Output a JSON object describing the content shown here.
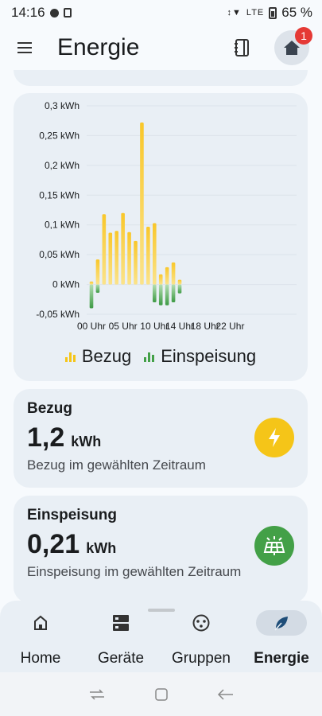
{
  "status_bar": {
    "time": "14:16",
    "network": "LTE",
    "battery": "65 %"
  },
  "app_bar": {
    "title": "Energie",
    "badge_count": "1"
  },
  "chart_data": {
    "type": "bar",
    "ylim": [
      -0.05,
      0.3
    ],
    "y_ticks": [
      "0,3 kWh",
      "0,25 kWh",
      "0,2 kWh",
      "0,15 kWh",
      "0,1 kWh",
      "0,05 kWh",
      "0 kWh",
      "-0,05 kWh"
    ],
    "y_tick_values": [
      0.3,
      0.25,
      0.2,
      0.15,
      0.1,
      0.05,
      0,
      -0.05
    ],
    "x_ticks": [
      "00 Uhr",
      "05 Uhr",
      "10 Uhr",
      "14 Uhr",
      "18 Uhr",
      "22 Uhr"
    ],
    "x_tick_hours": [
      0,
      5,
      10,
      14,
      18,
      22
    ],
    "hours": [
      0,
      1,
      2,
      3,
      4,
      5,
      6,
      7,
      8,
      9,
      10,
      11,
      12,
      13,
      14,
      15
    ],
    "series": [
      {
        "name": "Bezug",
        "color": "#f5c518",
        "values": [
          0.005,
          0.042,
          0.118,
          0.087,
          0.09,
          0.12,
          0.088,
          0.073,
          0.272,
          0.097,
          0.103,
          0.017,
          0.029,
          0.037,
          0.008,
          0.0
        ]
      },
      {
        "name": "Einspeisung",
        "color": "#43a047",
        "values": [
          -0.04,
          -0.014,
          0.0,
          0.0,
          0.0,
          0.0,
          0.0,
          0.0,
          0.0,
          0.0,
          -0.03,
          -0.035,
          -0.035,
          -0.03,
          -0.015,
          0.0
        ]
      }
    ]
  },
  "legend": {
    "bezug": "Bezug",
    "einspeisung": "Einspeisung"
  },
  "bezug_card": {
    "title": "Bezug",
    "value": "1,2",
    "unit": "kWh",
    "description": "Bezug im gewählten Zeitraum",
    "color": "#f5c518"
  },
  "einspeisung_card": {
    "title": "Einspeisung",
    "value": "0,21",
    "unit": "kWh",
    "description": "Einspeisung im gewählten Zeitraum",
    "color": "#43a047"
  },
  "nav": {
    "items": [
      {
        "label": "Home",
        "icon": "home-icon"
      },
      {
        "label": "Geräte",
        "icon": "devices-icon"
      },
      {
        "label": "Gruppen",
        "icon": "groups-icon"
      },
      {
        "label": "Energie",
        "icon": "leaf-icon"
      }
    ],
    "active": "Energie"
  }
}
